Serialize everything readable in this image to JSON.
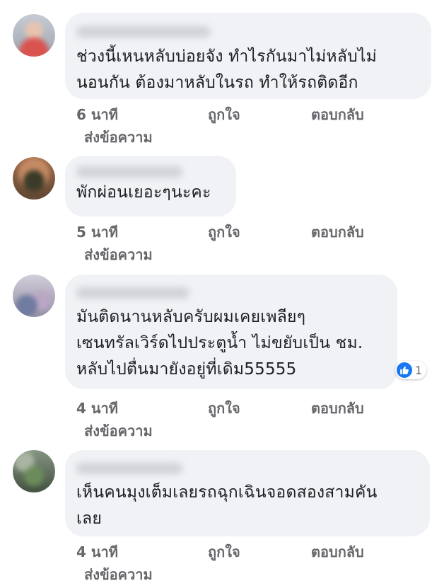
{
  "comments": [
    {
      "text": "ช่วงนี้เหนหลับบ่อยจัง ทำไรกันมาไม่หลับไม่\nนอนกัน ต้องมาหลับในรถ ทำให้รถติดอีก",
      "time": "6 นาที",
      "like": "ถูกใจ",
      "reply": "ตอบกลับ",
      "message": "ส่งข้อความ"
    },
    {
      "text": "พักผ่อนเยอะๆนะคะ",
      "time": "5 นาที",
      "like": "ถูกใจ",
      "reply": "ตอบกลับ",
      "message": "ส่งข้อความ"
    },
    {
      "text": "มันติดนานหลับครับผมเคยเพลียๆ\nเซนทรัลเวิร์ดไปประตูน้ำ ไม่ขยับเป็น ชม.\nหลับไปตื่นมายังอยู่ที่เดิม55555",
      "time": "4 นาที",
      "like": "ถูกใจ",
      "reply": "ตอบกลับ",
      "message": "ส่งข้อความ",
      "reaction_count": "1"
    },
    {
      "text": "เห็นคนมุงเต็มเลยรถฉุกเฉินจอดสองสามคัน\nเลย",
      "time": "4 นาที",
      "like": "ถูกใจ",
      "reply": "ตอบกลับ",
      "message": "ส่งข้อความ"
    }
  ],
  "colors": {
    "bubble": "#f0f2f5",
    "meta_text": "#65676b",
    "like_blue": "#1877f2"
  }
}
